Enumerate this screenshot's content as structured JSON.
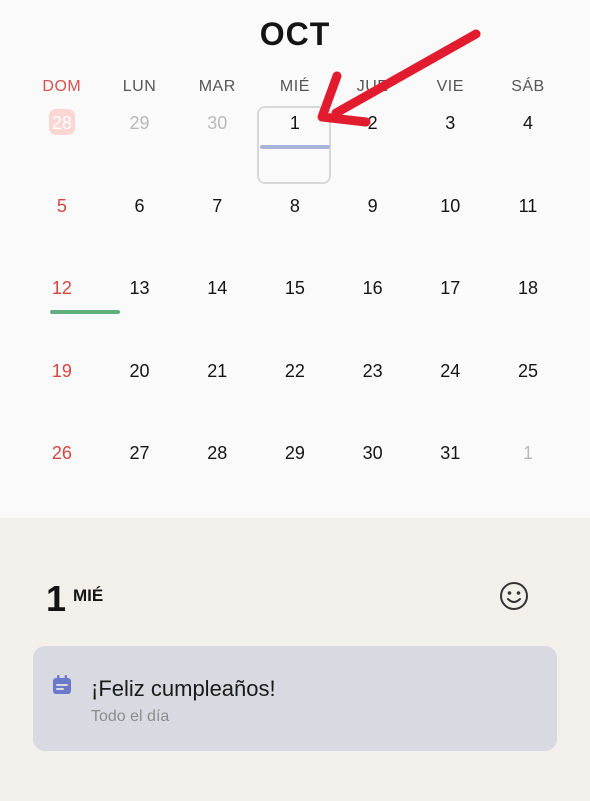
{
  "calendar": {
    "month": "OCT",
    "weekdays": [
      "DOM",
      "LUN",
      "MAR",
      "MIÉ",
      "JUE",
      "VIE",
      "SÁB"
    ],
    "weeks": [
      [
        "28",
        "29",
        "30",
        "1",
        "2",
        "3",
        "4"
      ],
      [
        "5",
        "6",
        "7",
        "8",
        "9",
        "10",
        "11"
      ],
      [
        "12",
        "13",
        "14",
        "15",
        "16",
        "17",
        "18"
      ],
      [
        "19",
        "20",
        "21",
        "22",
        "23",
        "24",
        "25"
      ],
      [
        "26",
        "27",
        "28",
        "29",
        "30",
        "31",
        "1"
      ]
    ],
    "colors": {
      "sunday": "#d6463f",
      "muted": "#b9b9b9",
      "event_bar": "#a9b3da",
      "holiday_bar": "#5fae7d",
      "today_badge": "#fbd6d3",
      "arrow": "#e31b2e"
    }
  },
  "selected_day": {
    "number": "1",
    "weekday": "MIÉ",
    "icon": "smile-icon"
  },
  "event": {
    "title": "¡Feliz cumpleaños!",
    "subtitle": "Todo el día",
    "icon": "calendar-icon",
    "card_color": "#d9d9e2"
  }
}
